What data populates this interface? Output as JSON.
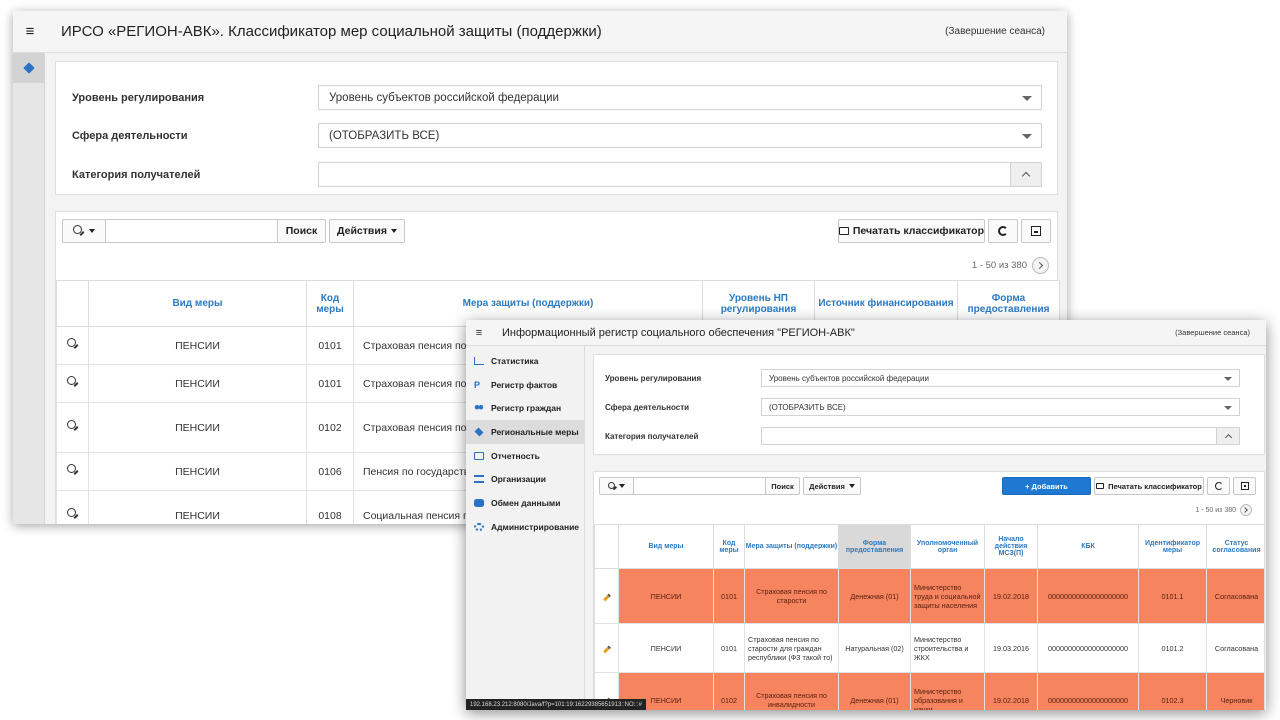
{
  "window_back": {
    "menu_glyph": "≡",
    "title": "ИРСО «РЕГИОН-АВК». Классификатор мер социальной защиты (поддержки)",
    "logout": "(Завершение сеанса)",
    "filters": {
      "level_label": "Уровень регулирования",
      "level_value": "Уровень субъектов российской федерации",
      "sphere_label": "Сфера деятельности",
      "sphere_value": "(ОТОБРАЗИТЬ ВСЕ)",
      "category_label": "Категория получателей",
      "category_value": ""
    },
    "toolbar": {
      "search_label": "Поиск",
      "actions_label": "Действия",
      "print_label": "Печатать классификатор"
    },
    "pager": "1 - 50 из 380",
    "columns": [
      "Вид меры",
      "Код меры",
      "Мера защиты (поддержки)",
      "Уровень НП регулирования",
      "Источник финансирования",
      "Форма предоставления"
    ],
    "rows": [
      {
        "kind": "ПЕНСИИ",
        "code": "0101",
        "measure": "Страховая пенсия по ст"
      },
      {
        "kind": "ПЕНСИИ",
        "code": "0101",
        "measure": "Страховая пенсия по ст"
      },
      {
        "kind": "ПЕНСИИ",
        "code": "0102",
        "measure": "Страховая пенсия по ин"
      },
      {
        "kind": "ПЕНСИИ",
        "code": "0106",
        "measure": "Пенсия по государствен кормильца"
      },
      {
        "kind": "ПЕНСИИ",
        "code": "0108",
        "measure": "Социальная пенсия по"
      }
    ]
  },
  "window_front": {
    "menu_glyph": "≡",
    "title": "Информационный регистр социального обеспечения \"РЕГИОН-АВК\"",
    "logout": "(Завершение сеанса)",
    "sidebar": [
      {
        "label": "Статистика",
        "icon": "chart-icon"
      },
      {
        "label": "Регистр фактов",
        "icon": "p-icon"
      },
      {
        "label": "Регистр граждан",
        "icon": "users-icon"
      },
      {
        "label": "Региональные меры",
        "icon": "cube-icon"
      },
      {
        "label": "Отчетность",
        "icon": "edit-icon"
      },
      {
        "label": "Организации",
        "icon": "bank-icon"
      },
      {
        "label": "Обмен данными",
        "icon": "database-icon"
      },
      {
        "label": "Администрирование",
        "icon": "gears-icon"
      }
    ],
    "filters": {
      "level_label": "Уровень регулирования",
      "level_value": "Уровень субъектов российской федерации",
      "sphere_label": "Сфера деятельности",
      "sphere_value": "(ОТОБРАЗИТЬ ВСЕ)",
      "category_label": "Категория получателей",
      "category_value": ""
    },
    "toolbar": {
      "search_label": "Поиск",
      "actions_label": "Действия",
      "add_label": "+ Добавить",
      "print_label": "Печатать классификатор"
    },
    "pager": "1 - 50 из 380",
    "columns": [
      "Вид меры",
      "Код меры",
      "Мера защиты (поддержки)",
      "Форма предоставления",
      "Уполномоченный орган",
      "Начало действия МСЗ(П)",
      "КБК",
      "Идентификатор меры",
      "Статус согласования"
    ],
    "rows": [
      {
        "kind": "ПЕНСИИ",
        "code": "0101",
        "measure": "Страховая пенсия по старости",
        "form": "Денежная (01)",
        "org": "Министерство труда и социальной защиты населения",
        "start": "19.02.2018",
        "kbk": "00000000000000000000",
        "id": "0101.1",
        "status": "Согласована"
      },
      {
        "kind": "ПЕНСИИ",
        "code": "0101",
        "measure": "Страховая пенсия по старости для граждан республики (ФЗ такой то)",
        "form": "Натуральная (02)",
        "org": "Министерство строительства и ЖКХ",
        "start": "19.03.2016",
        "kbk": "00000000000000000000",
        "id": "0101.2",
        "status": "Согласована"
      },
      {
        "kind": "ПЕНСИИ",
        "code": "0102",
        "measure": "Страховая пенсия по инвалидности",
        "form": "Денежная (01)",
        "org": "Министерство образования и науки",
        "start": "19.02.2018",
        "kbk": "00000000000000000000",
        "id": "0102.3",
        "status": "Черновик"
      }
    ],
    "statusbar": "192.168.23.212:8080/Java/f?p=101:19:16229385651913::NO:::#",
    "colors": {
      "highlight": "#f5845f",
      "accent": "#1f78d1",
      "header_text": "#2a7ac4"
    }
  }
}
